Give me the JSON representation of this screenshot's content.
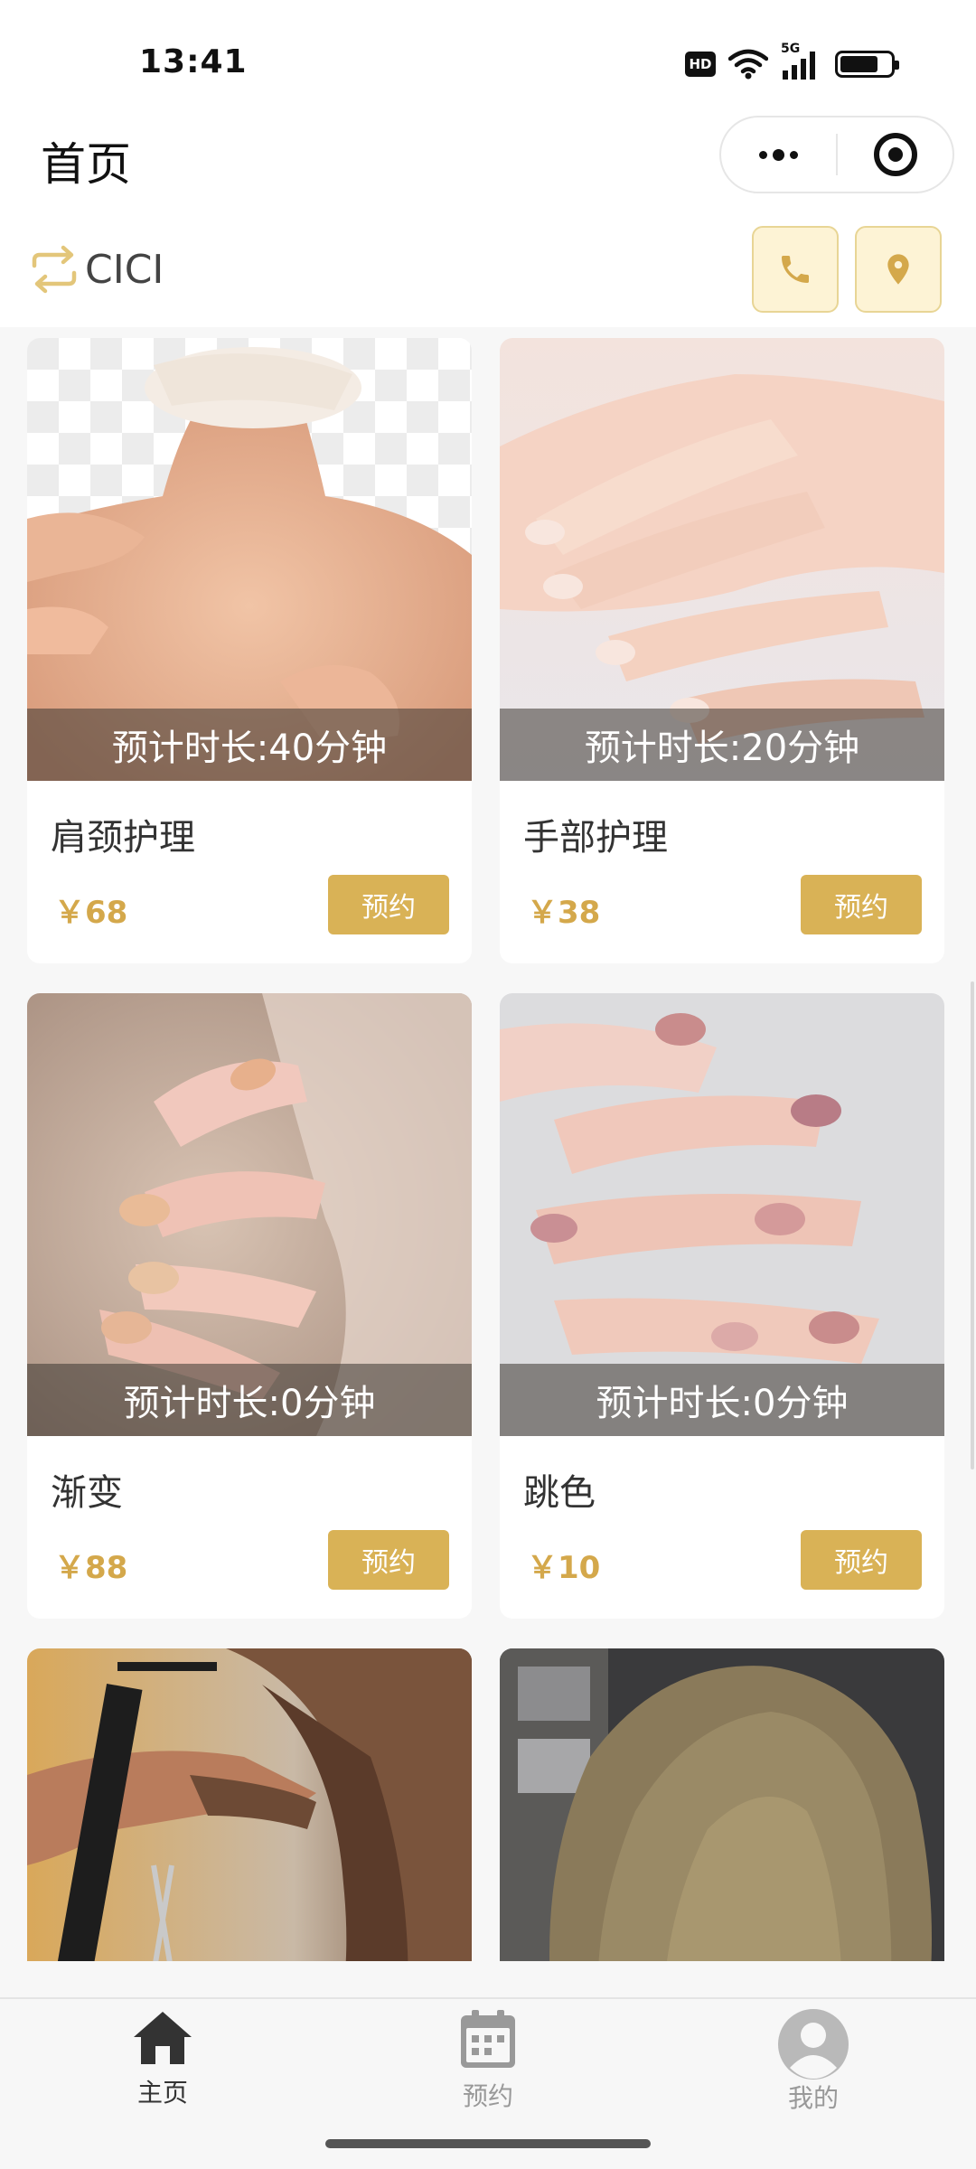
{
  "status_bar": {
    "time": "13:41",
    "hd": "HD",
    "network": "5G",
    "battery_level": 0.75
  },
  "nav": {
    "title": "首页"
  },
  "shop": {
    "name": "CICI"
  },
  "services": [
    {
      "duration": "预计时长:40分钟",
      "name": "肩颈护理",
      "price": "￥68",
      "button": "预约"
    },
    {
      "duration": "预计时长:20分钟",
      "name": "手部护理",
      "price": "￥38",
      "button": "预约"
    },
    {
      "duration": "预计时长:0分钟",
      "name": "渐变",
      "price": "￥88",
      "button": "预约"
    },
    {
      "duration": "预计时长:0分钟",
      "name": "跳色",
      "price": "￥10",
      "button": "预约"
    }
  ],
  "tabs": [
    {
      "label": "主页",
      "icon": "home-icon",
      "active": true
    },
    {
      "label": "预约",
      "icon": "calendar-icon",
      "active": false
    },
    {
      "label": "我的",
      "icon": "profile-icon",
      "active": false
    }
  ],
  "colors": {
    "accent": "#d9b256",
    "price": "#d4a84b",
    "tab_active": "#333333",
    "tab_inactive": "#999999"
  }
}
